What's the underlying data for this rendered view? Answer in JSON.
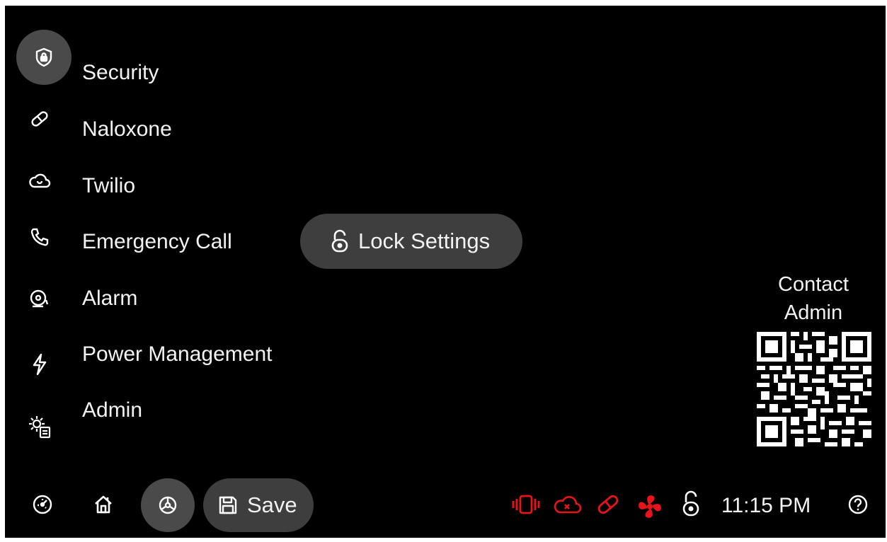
{
  "menu": {
    "items": [
      {
        "label": "Security",
        "icon": "shield-lock-icon",
        "active": true
      },
      {
        "label": "Naloxone",
        "icon": "pill-icon"
      },
      {
        "label": "Twilio",
        "icon": "cloud-icon"
      },
      {
        "label": "Emergency Call",
        "icon": "phone-icon"
      },
      {
        "label": "Alarm",
        "icon": "alarm-bell-icon"
      },
      {
        "label": "Power Management",
        "icon": "lightning-icon"
      },
      {
        "label": "Admin",
        "icon": "admin-gear-icon"
      }
    ]
  },
  "lock_settings": {
    "label": "Lock Settings",
    "icon": "unlocked-padlock-icon"
  },
  "contact": {
    "line1": "Contact",
    "line2": "Admin",
    "qr": "qr-code-icon"
  },
  "bottom_bar": {
    "left_icons": [
      "dashboard-gauge-icon",
      "home-icon",
      "settings-wheel-icon"
    ],
    "save_label": "Save",
    "status_icons": [
      "vibration-alert-icon",
      "cloud-error-icon",
      "pill-alert-icon",
      "fan-alert-icon",
      "unlocked-padlock-icon"
    ],
    "time": "11:15 PM",
    "help_icon": "help-icon"
  },
  "colors": {
    "background": "#000000",
    "pill": "#3e3e3e",
    "active_circle": "#4a4a4a",
    "text": "#f2f2f2",
    "alert_red": "#e8141c"
  }
}
